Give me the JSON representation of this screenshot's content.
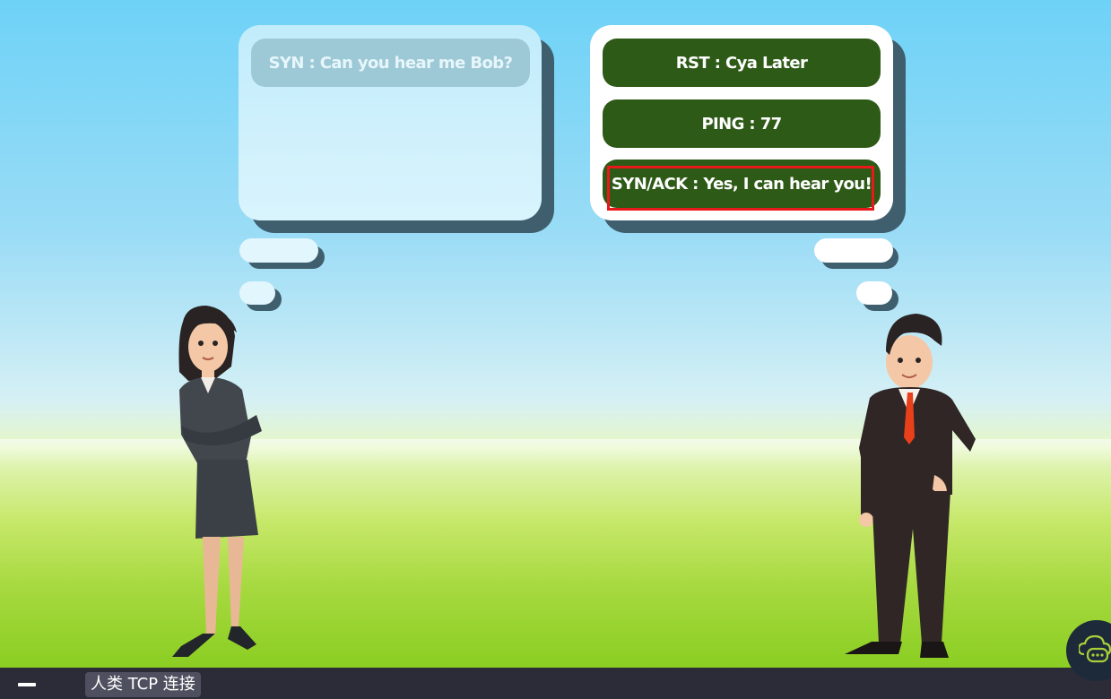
{
  "scene": {
    "left_bubble": {
      "message": "SYN : Can you hear me Bob?"
    },
    "right_bubble": {
      "options": [
        {
          "label": "RST : Cya Later"
        },
        {
          "label": "PING : 77"
        },
        {
          "label": "SYN/ACK : Yes, I can hear you!"
        }
      ],
      "highlighted_option": "SYN/ACK : Yes, I can hear you!"
    }
  },
  "taskbar": {
    "title": "人类 TCP 连接"
  },
  "icons": {
    "minimize": "minimize-icon",
    "chat": "chat-cloud-icon"
  },
  "colors": {
    "option_bg": "#2d5a16",
    "highlight_border": "#e8191b",
    "faded_pill": "#9dc9d6"
  }
}
